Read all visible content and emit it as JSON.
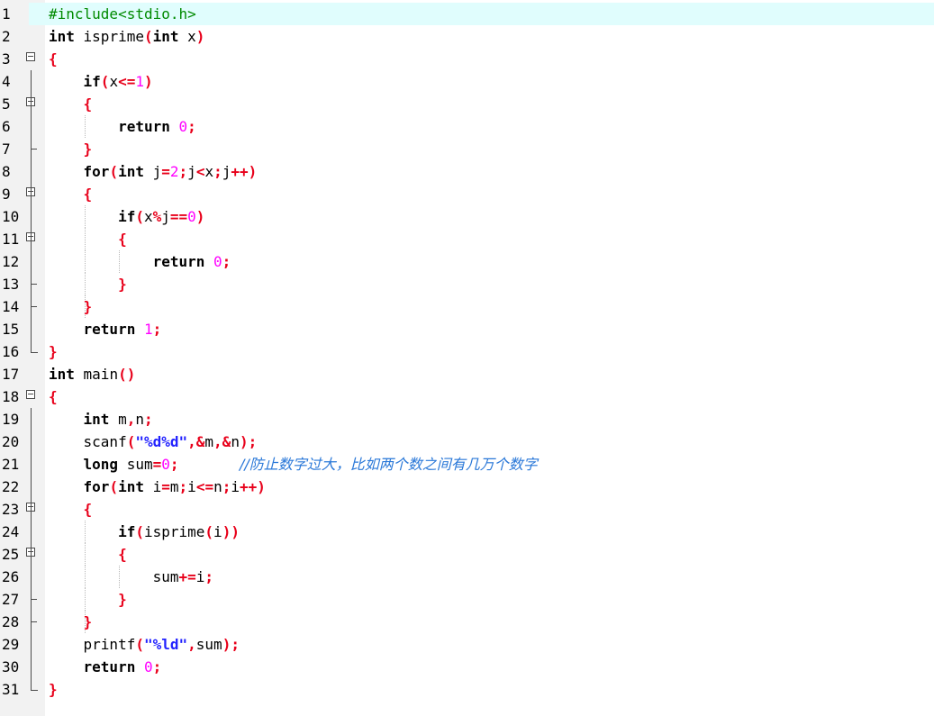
{
  "editor": {
    "colors": {
      "keyword": "#000000",
      "operator": "#e8001a",
      "number": "#ff00ff",
      "string": "#2222ff",
      "preprocessor": "#008a00",
      "comment": "#2a78d8",
      "current_line": "#e0fdfd"
    },
    "lines": [
      {
        "n": "1",
        "tokens": [
          {
            "t": "pre",
            "v": "#include<stdio.h>"
          }
        ]
      },
      {
        "n": "2",
        "tokens": [
          {
            "t": "kw",
            "v": "int"
          },
          {
            "t": "p",
            "v": " isprime"
          },
          {
            "t": "op",
            "v": "("
          },
          {
            "t": "kw",
            "v": "int"
          },
          {
            "t": "p",
            "v": " x"
          },
          {
            "t": "op",
            "v": ")"
          }
        ]
      },
      {
        "n": "3",
        "tokens": [
          {
            "t": "op",
            "v": "{"
          }
        ]
      },
      {
        "n": "4",
        "tokens": [
          {
            "t": "p",
            "v": "    "
          },
          {
            "t": "kw",
            "v": "if"
          },
          {
            "t": "op",
            "v": "("
          },
          {
            "t": "p",
            "v": "x"
          },
          {
            "t": "op",
            "v": "<="
          },
          {
            "t": "num",
            "v": "1"
          },
          {
            "t": "op",
            "v": ")"
          }
        ]
      },
      {
        "n": "5",
        "tokens": [
          {
            "t": "p",
            "v": "    "
          },
          {
            "t": "op",
            "v": "{"
          }
        ]
      },
      {
        "n": "6",
        "tokens": [
          {
            "t": "p",
            "v": "        "
          },
          {
            "t": "kw",
            "v": "return"
          },
          {
            "t": "p",
            "v": " "
          },
          {
            "t": "num",
            "v": "0"
          },
          {
            "t": "op",
            "v": ";"
          }
        ]
      },
      {
        "n": "7",
        "tokens": [
          {
            "t": "p",
            "v": "    "
          },
          {
            "t": "op",
            "v": "}"
          }
        ]
      },
      {
        "n": "8",
        "tokens": [
          {
            "t": "p",
            "v": "    "
          },
          {
            "t": "kw",
            "v": "for"
          },
          {
            "t": "op",
            "v": "("
          },
          {
            "t": "kw",
            "v": "int"
          },
          {
            "t": "p",
            "v": " j"
          },
          {
            "t": "op",
            "v": "="
          },
          {
            "t": "num",
            "v": "2"
          },
          {
            "t": "op",
            "v": ";"
          },
          {
            "t": "p",
            "v": "j"
          },
          {
            "t": "op",
            "v": "<"
          },
          {
            "t": "p",
            "v": "x"
          },
          {
            "t": "op",
            "v": ";"
          },
          {
            "t": "p",
            "v": "j"
          },
          {
            "t": "op",
            "v": "++)"
          }
        ]
      },
      {
        "n": "9",
        "tokens": [
          {
            "t": "p",
            "v": "    "
          },
          {
            "t": "op",
            "v": "{"
          }
        ]
      },
      {
        "n": "10",
        "tokens": [
          {
            "t": "p",
            "v": "        "
          },
          {
            "t": "kw",
            "v": "if"
          },
          {
            "t": "op",
            "v": "("
          },
          {
            "t": "p",
            "v": "x"
          },
          {
            "t": "op",
            "v": "%"
          },
          {
            "t": "p",
            "v": "j"
          },
          {
            "t": "op",
            "v": "=="
          },
          {
            "t": "num",
            "v": "0"
          },
          {
            "t": "op",
            "v": ")"
          }
        ]
      },
      {
        "n": "11",
        "tokens": [
          {
            "t": "p",
            "v": "        "
          },
          {
            "t": "op",
            "v": "{"
          }
        ]
      },
      {
        "n": "12",
        "tokens": [
          {
            "t": "p",
            "v": "            "
          },
          {
            "t": "kw",
            "v": "return"
          },
          {
            "t": "p",
            "v": " "
          },
          {
            "t": "num",
            "v": "0"
          },
          {
            "t": "op",
            "v": ";"
          }
        ]
      },
      {
        "n": "13",
        "tokens": [
          {
            "t": "p",
            "v": "        "
          },
          {
            "t": "op",
            "v": "}"
          }
        ]
      },
      {
        "n": "14",
        "tokens": [
          {
            "t": "p",
            "v": "    "
          },
          {
            "t": "op",
            "v": "}"
          }
        ]
      },
      {
        "n": "15",
        "tokens": [
          {
            "t": "p",
            "v": "    "
          },
          {
            "t": "kw",
            "v": "return"
          },
          {
            "t": "p",
            "v": " "
          },
          {
            "t": "num",
            "v": "1"
          },
          {
            "t": "op",
            "v": ";"
          }
        ]
      },
      {
        "n": "16",
        "tokens": [
          {
            "t": "op",
            "v": "}"
          }
        ]
      },
      {
        "n": "17",
        "tokens": [
          {
            "t": "kw",
            "v": "int"
          },
          {
            "t": "p",
            "v": " main"
          },
          {
            "t": "op",
            "v": "()"
          }
        ]
      },
      {
        "n": "18",
        "tokens": [
          {
            "t": "op",
            "v": "{"
          }
        ]
      },
      {
        "n": "19",
        "tokens": [
          {
            "t": "p",
            "v": "    "
          },
          {
            "t": "kw",
            "v": "int"
          },
          {
            "t": "p",
            "v": " m"
          },
          {
            "t": "op",
            "v": ","
          },
          {
            "t": "p",
            "v": "n"
          },
          {
            "t": "op",
            "v": ";"
          }
        ]
      },
      {
        "n": "20",
        "tokens": [
          {
            "t": "p",
            "v": "    scanf"
          },
          {
            "t": "op",
            "v": "("
          },
          {
            "t": "str",
            "v": "\"%d%d\""
          },
          {
            "t": "op",
            "v": ",&"
          },
          {
            "t": "p",
            "v": "m"
          },
          {
            "t": "op",
            "v": ",&"
          },
          {
            "t": "p",
            "v": "n"
          },
          {
            "t": "op",
            "v": ");"
          }
        ]
      },
      {
        "n": "21",
        "tokens": [
          {
            "t": "p",
            "v": "    "
          },
          {
            "t": "kw",
            "v": "long"
          },
          {
            "t": "p",
            "v": " sum"
          },
          {
            "t": "op",
            "v": "="
          },
          {
            "t": "num",
            "v": "0"
          },
          {
            "t": "op",
            "v": ";"
          },
          {
            "t": "p",
            "v": "       "
          },
          {
            "t": "cm",
            "v": "//防止数字过大，比如两个数之间有几万个数字"
          }
        ]
      },
      {
        "n": "22",
        "tokens": [
          {
            "t": "p",
            "v": "    "
          },
          {
            "t": "kw",
            "v": "for"
          },
          {
            "t": "op",
            "v": "("
          },
          {
            "t": "kw",
            "v": "int"
          },
          {
            "t": "p",
            "v": " i"
          },
          {
            "t": "op",
            "v": "="
          },
          {
            "t": "p",
            "v": "m"
          },
          {
            "t": "op",
            "v": ";"
          },
          {
            "t": "p",
            "v": "i"
          },
          {
            "t": "op",
            "v": "<="
          },
          {
            "t": "p",
            "v": "n"
          },
          {
            "t": "op",
            "v": ";"
          },
          {
            "t": "p",
            "v": "i"
          },
          {
            "t": "op",
            "v": "++)"
          }
        ]
      },
      {
        "n": "23",
        "tokens": [
          {
            "t": "p",
            "v": "    "
          },
          {
            "t": "op",
            "v": "{"
          }
        ]
      },
      {
        "n": "24",
        "tokens": [
          {
            "t": "p",
            "v": "        "
          },
          {
            "t": "kw",
            "v": "if"
          },
          {
            "t": "op",
            "v": "("
          },
          {
            "t": "p",
            "v": "isprime"
          },
          {
            "t": "op",
            "v": "("
          },
          {
            "t": "p",
            "v": "i"
          },
          {
            "t": "op",
            "v": "))"
          }
        ]
      },
      {
        "n": "25",
        "tokens": [
          {
            "t": "p",
            "v": "        "
          },
          {
            "t": "op",
            "v": "{"
          }
        ]
      },
      {
        "n": "26",
        "tokens": [
          {
            "t": "p",
            "v": "            sum"
          },
          {
            "t": "op",
            "v": "+="
          },
          {
            "t": "p",
            "v": "i"
          },
          {
            "t": "op",
            "v": ";"
          }
        ]
      },
      {
        "n": "27",
        "tokens": [
          {
            "t": "p",
            "v": "        "
          },
          {
            "t": "op",
            "v": "}"
          }
        ]
      },
      {
        "n": "28",
        "tokens": [
          {
            "t": "p",
            "v": "    "
          },
          {
            "t": "op",
            "v": "}"
          }
        ]
      },
      {
        "n": "29",
        "tokens": [
          {
            "t": "p",
            "v": "    printf"
          },
          {
            "t": "op",
            "v": "("
          },
          {
            "t": "str",
            "v": "\"%ld\""
          },
          {
            "t": "op",
            "v": ","
          },
          {
            "t": "p",
            "v": "sum"
          },
          {
            "t": "op",
            "v": ");"
          }
        ]
      },
      {
        "n": "30",
        "tokens": [
          {
            "t": "p",
            "v": "    "
          },
          {
            "t": "kw",
            "v": "return"
          },
          {
            "t": "p",
            "v": " "
          },
          {
            "t": "num",
            "v": "0"
          },
          {
            "t": "op",
            "v": ";"
          }
        ]
      },
      {
        "n": "31",
        "tokens": [
          {
            "t": "op",
            "v": "}"
          }
        ]
      }
    ]
  }
}
